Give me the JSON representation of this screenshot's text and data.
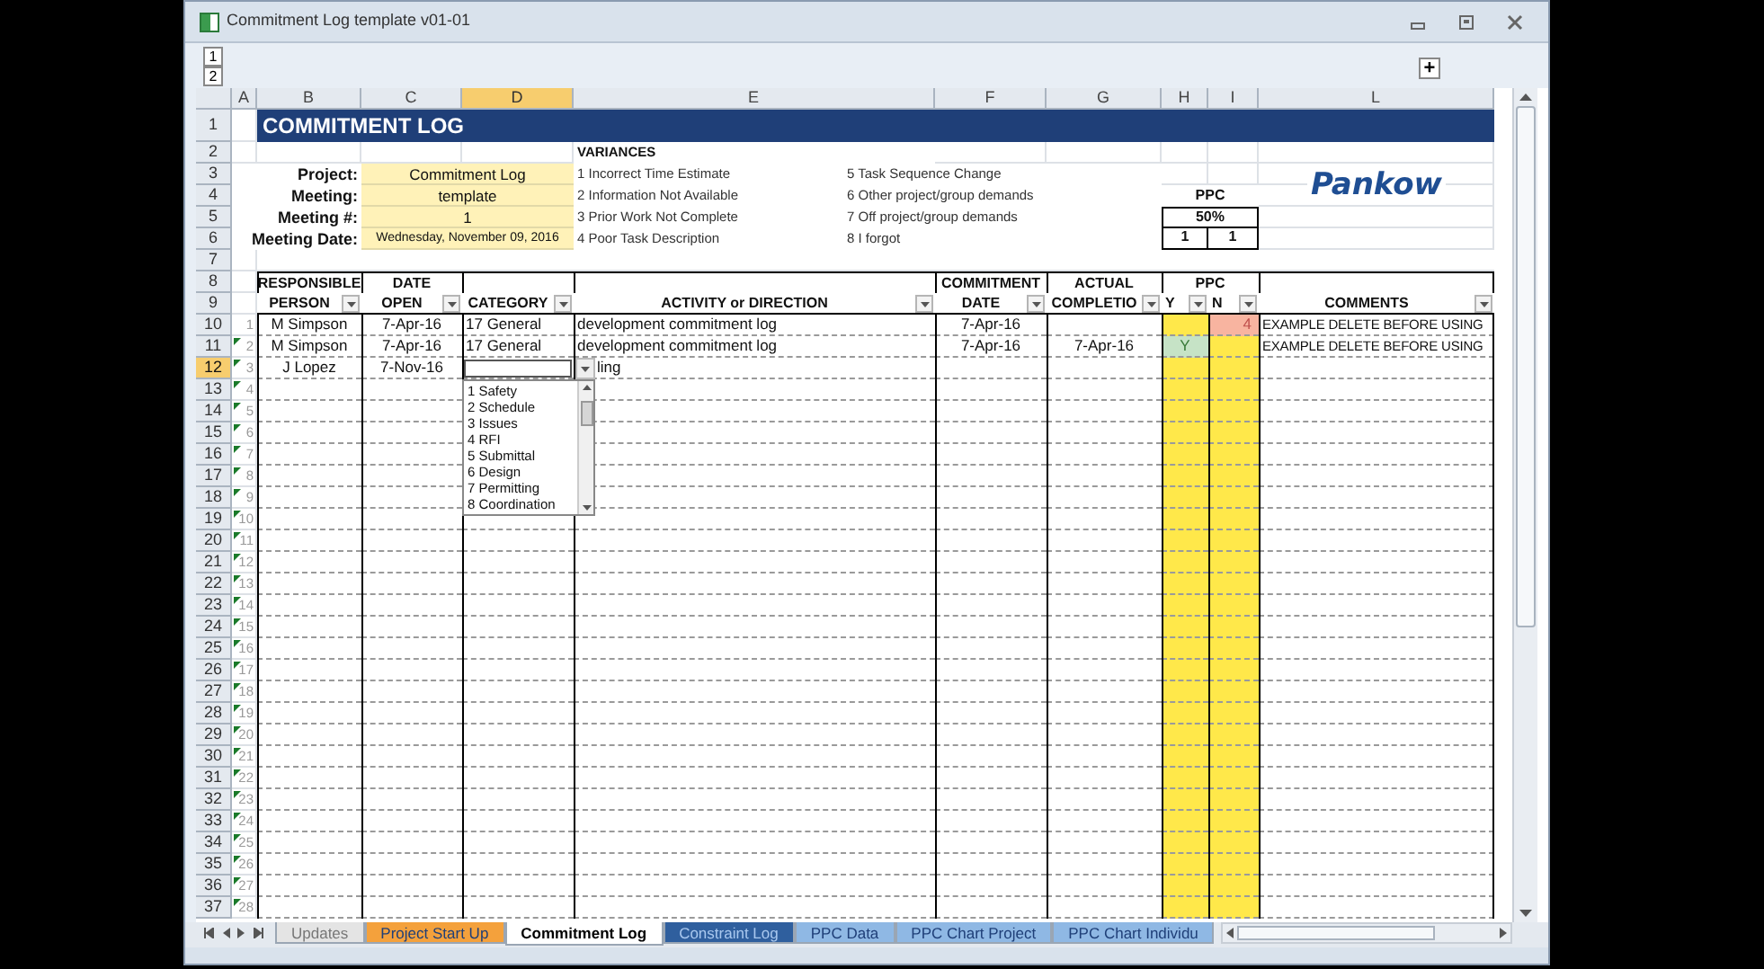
{
  "window": {
    "title": "Commitment Log template v01-01"
  },
  "outline": {
    "levels": [
      "1",
      "2"
    ],
    "expand": "+"
  },
  "column_headers": [
    {
      "label": "A",
      "selected": false
    },
    {
      "label": "B",
      "selected": false
    },
    {
      "label": "C",
      "selected": false
    },
    {
      "label": "D",
      "selected": true
    },
    {
      "label": "E",
      "selected": false
    },
    {
      "label": "F",
      "selected": false
    },
    {
      "label": "G",
      "selected": false
    },
    {
      "label": "H",
      "selected": false
    },
    {
      "label": "I",
      "selected": false
    },
    {
      "label": "L",
      "selected": false
    }
  ],
  "row_headers": [
    {
      "label": "1",
      "selected": false
    },
    {
      "label": "2",
      "selected": false
    },
    {
      "label": "3",
      "selected": false
    },
    {
      "label": "4",
      "selected": false
    },
    {
      "label": "5",
      "selected": false
    },
    {
      "label": "6",
      "selected": false
    },
    {
      "label": "7",
      "selected": false
    },
    {
      "label": "8",
      "selected": false
    },
    {
      "label": "9",
      "selected": false
    },
    {
      "label": "10",
      "selected": false
    },
    {
      "label": "11",
      "selected": false
    },
    {
      "label": "12",
      "selected": true
    },
    {
      "label": "13",
      "selected": false
    },
    {
      "label": "14",
      "selected": false
    },
    {
      "label": "15",
      "selected": false
    },
    {
      "label": "16",
      "selected": false
    },
    {
      "label": "17",
      "selected": false
    },
    {
      "label": "18",
      "selected": false
    },
    {
      "label": "19",
      "selected": false
    },
    {
      "label": "20",
      "selected": false
    },
    {
      "label": "21",
      "selected": false
    },
    {
      "label": "22",
      "selected": false
    },
    {
      "label": "23",
      "selected": false
    },
    {
      "label": "24",
      "selected": false
    },
    {
      "label": "25",
      "selected": false
    },
    {
      "label": "26",
      "selected": false
    },
    {
      "label": "27",
      "selected": false
    },
    {
      "label": "28",
      "selected": false
    },
    {
      "label": "29",
      "selected": false
    },
    {
      "label": "30",
      "selected": false
    },
    {
      "label": "31",
      "selected": false
    },
    {
      "label": "32",
      "selected": false
    },
    {
      "label": "33",
      "selected": false
    },
    {
      "label": "34",
      "selected": false
    },
    {
      "label": "35",
      "selected": false
    },
    {
      "label": "36",
      "selected": false
    },
    {
      "label": "37",
      "selected": false
    }
  ],
  "sheet_title": "COMMITMENT LOG",
  "meeting_fields": [
    {
      "label": "Project:",
      "value": "Commitment Log"
    },
    {
      "label": "Meeting:",
      "value": "template"
    },
    {
      "label": "Meeting #:",
      "value": "1"
    },
    {
      "label": "Meeting Date:",
      "value": "Wednesday, November 09, 2016",
      "kind": "small"
    }
  ],
  "variances": {
    "heading": "VARIANCES",
    "items": [
      "1 Incorrect Time Estimate",
      "2 Information Not Available",
      "3 Prior Work Not Complete",
      "4 Poor Task Description",
      "5 Task Sequence Change",
      "6 Other project/group demands",
      "7 Off project/group demands",
      "8 I forgot"
    ]
  },
  "ppc_summary": {
    "heading": "PPC",
    "percent": "50%",
    "yes": "1",
    "no": "1"
  },
  "logo": "Pankow",
  "table_header": {
    "group": "PPC",
    "columns": [
      {
        "top": "RESPONSIBLE",
        "label": "PERSON"
      },
      {
        "top": "DATE",
        "label": "OPEN"
      },
      {
        "label": "CATEGORY"
      },
      {
        "label": "ACTIVITY or DIRECTION"
      },
      {
        "top": "COMMITMENT",
        "label": "DATE"
      },
      {
        "top": "ACTUAL",
        "label": "COMPLETIO"
      },
      {
        "label": "Y"
      },
      {
        "label": "N"
      },
      {
        "label": "COMMENTS"
      }
    ]
  },
  "log_rows": [
    {
      "index": "1",
      "flagged": false,
      "person": "M Simpson",
      "date_open": "7-Apr-16",
      "category": "17 General",
      "activity": "development commitment log",
      "commitment_date": "7-Apr-16",
      "ppc_y": {
        "color": "#ffe84a"
      },
      "ppc_n": {
        "value": "4",
        "color": "#f8b4a0"
      },
      "comments": "EXAMPLE DELETE BEFORE USING"
    },
    {
      "index": "2",
      "flagged": true,
      "person": "M Simpson",
      "date_open": "7-Apr-16",
      "category": "17 General",
      "activity": "development commitment log",
      "commitment_date": "7-Apr-16",
      "actual_completion": "7-Apr-16",
      "ppc_y": {
        "value": "Y",
        "color": "#c6e3c6"
      },
      "ppc_n": {
        "color": "#ffe84a"
      },
      "comments": "EXAMPLE DELETE BEFORE USING"
    },
    {
      "index": "3",
      "flagged": true,
      "person": "J Lopez",
      "date_open": "7-Nov-16",
      "activity": "ling",
      "category_dropdown": {
        "items": [
          "1 Safety",
          "2 Schedule",
          "3 Issues",
          "4 RFI",
          "5 Submittal",
          "6 Design",
          "7 Permitting",
          "8 Coordination"
        ]
      }
    },
    {
      "index": "4",
      "flagged": true
    },
    {
      "index": "5",
      "flagged": true
    },
    {
      "index": "6",
      "flagged": true
    },
    {
      "index": "7",
      "flagged": true
    },
    {
      "index": "8",
      "flagged": true
    },
    {
      "index": "9",
      "flagged": true
    },
    {
      "index": "10",
      "flagged": true
    },
    {
      "index": "11",
      "flagged": true
    },
    {
      "index": "12",
      "flagged": true
    },
    {
      "index": "13",
      "flagged": true
    },
    {
      "index": "14",
      "flagged": true
    },
    {
      "index": "15",
      "flagged": true
    },
    {
      "index": "16",
      "flagged": true
    },
    {
      "index": "17",
      "flagged": true
    },
    {
      "index": "18",
      "flagged": true
    },
    {
      "index": "19",
      "flagged": true
    },
    {
      "index": "20",
      "flagged": true
    },
    {
      "index": "21",
      "flagged": true
    },
    {
      "index": "22",
      "flagged": true
    },
    {
      "index": "23",
      "flagged": true
    },
    {
      "index": "24",
      "flagged": true
    },
    {
      "index": "25",
      "flagged": true
    },
    {
      "index": "26",
      "flagged": true
    },
    {
      "index": "27",
      "flagged": true
    },
    {
      "index": "28",
      "flagged": true
    }
  ],
  "sheet_tabs": [
    {
      "label": "Updates",
      "color": "#e4e4e4",
      "selected": false
    },
    {
      "label": "Project Start Up",
      "color": "#f4a13c",
      "selected": false
    },
    {
      "label": "Commitment Log",
      "color": "#ffffff",
      "selected": true
    },
    {
      "label": "Constraint Log",
      "color": "#2f5f9e",
      "selected": false
    },
    {
      "label": "PPC Data",
      "color": "#8fb8e4",
      "selected": false
    },
    {
      "label": "PPC Chart Project",
      "color": "#8fb8e4",
      "selected": false
    },
    {
      "label": "PPC Chart Individu",
      "color": "#8fb8e4",
      "selected": false
    }
  ]
}
